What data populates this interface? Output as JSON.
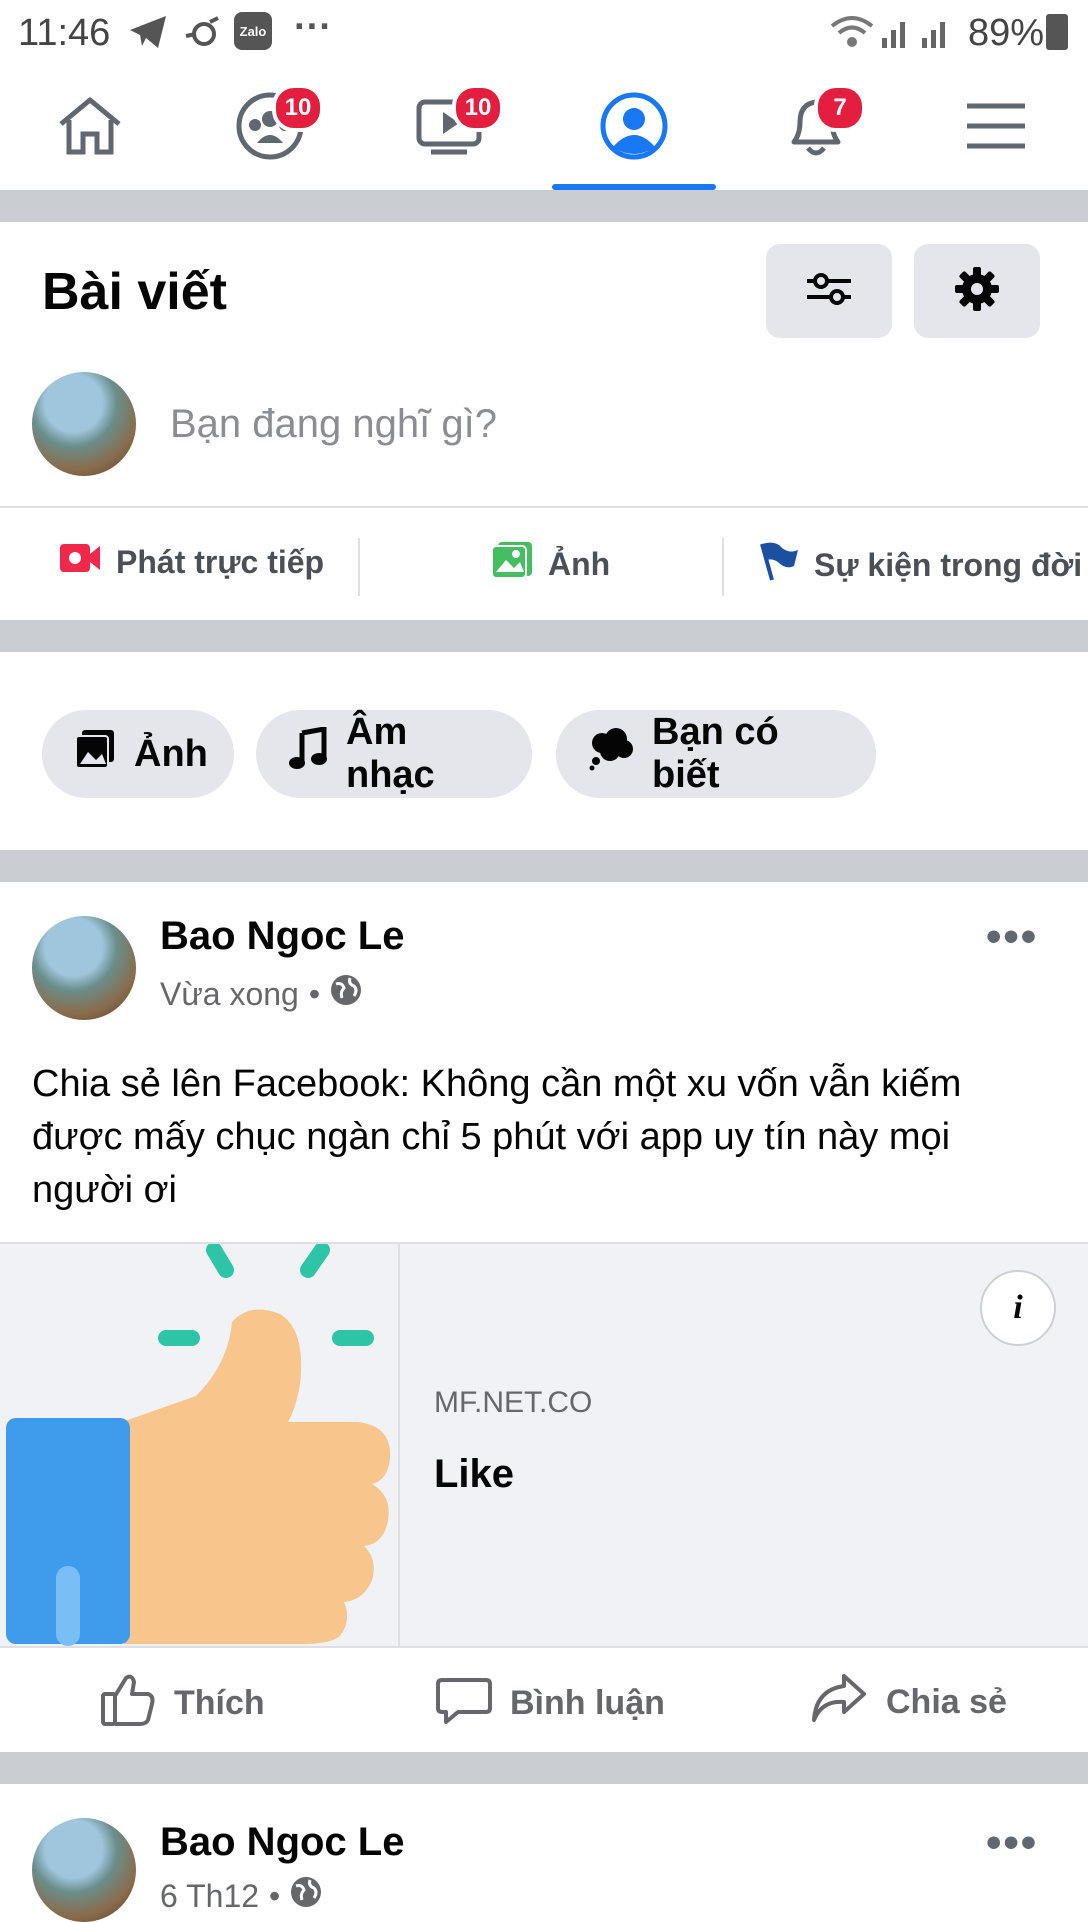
{
  "status_bar": {
    "time": "11:46",
    "battery": "89%",
    "icons": [
      "telegram-icon",
      "bird-icon",
      "zalo-icon",
      "more-dots-icon",
      "wifi-icon",
      "signal-icon",
      "battery-icon"
    ],
    "zalo_label": "Zalo",
    "more": "···"
  },
  "nav": {
    "tabs": [
      {
        "name": "home",
        "icon": "home-icon",
        "badge": ""
      },
      {
        "name": "groups",
        "icon": "groups-icon",
        "badge": "10"
      },
      {
        "name": "watch",
        "icon": "video-icon",
        "badge": "10"
      },
      {
        "name": "profile",
        "icon": "profile-icon",
        "badge": "",
        "active": true
      },
      {
        "name": "notifications",
        "icon": "bell-icon",
        "badge": "7"
      },
      {
        "name": "menu",
        "icon": "menu-icon",
        "badge": ""
      }
    ],
    "accent": "#1877f2"
  },
  "section": {
    "title": "Bài viết"
  },
  "composer": {
    "placeholder": "Bạn đang nghĩ gì?",
    "actions": [
      {
        "label": "Phát trực tiếp",
        "icon": "live-video-icon",
        "color": "#f02849"
      },
      {
        "label": "Ảnh",
        "icon": "photo-icon",
        "color": "#45bd62"
      },
      {
        "label": "Sự kiện trong đời",
        "icon": "flag-icon",
        "color": "#1b4fa0"
      }
    ]
  },
  "chips": [
    {
      "label": "Ảnh",
      "icon": "photo-icon"
    },
    {
      "label": "Âm nhạc",
      "icon": "music-note-icon"
    },
    {
      "label": "Bạn có biết",
      "icon": "thought-bubble-icon"
    }
  ],
  "posts": [
    {
      "author": "Bao Ngoc Le",
      "time": "Vừa xong",
      "dot": "•",
      "text": "Chia sẻ lên Facebook: Không cần một xu vốn vẫn kiếm được mấy chục ngàn chỉ 5 phút với app uy tín này mọi người ơi",
      "link": {
        "domain": "MF.NET.CO",
        "title": "Like",
        "info": "i"
      },
      "more": "•••"
    },
    {
      "author": "Bao Ngoc Le",
      "time": "6 Th12",
      "dot": "•",
      "more": "•••"
    }
  ],
  "reactions": {
    "like": "Thích",
    "comment": "Bình luận",
    "share": "Chia sẻ"
  }
}
